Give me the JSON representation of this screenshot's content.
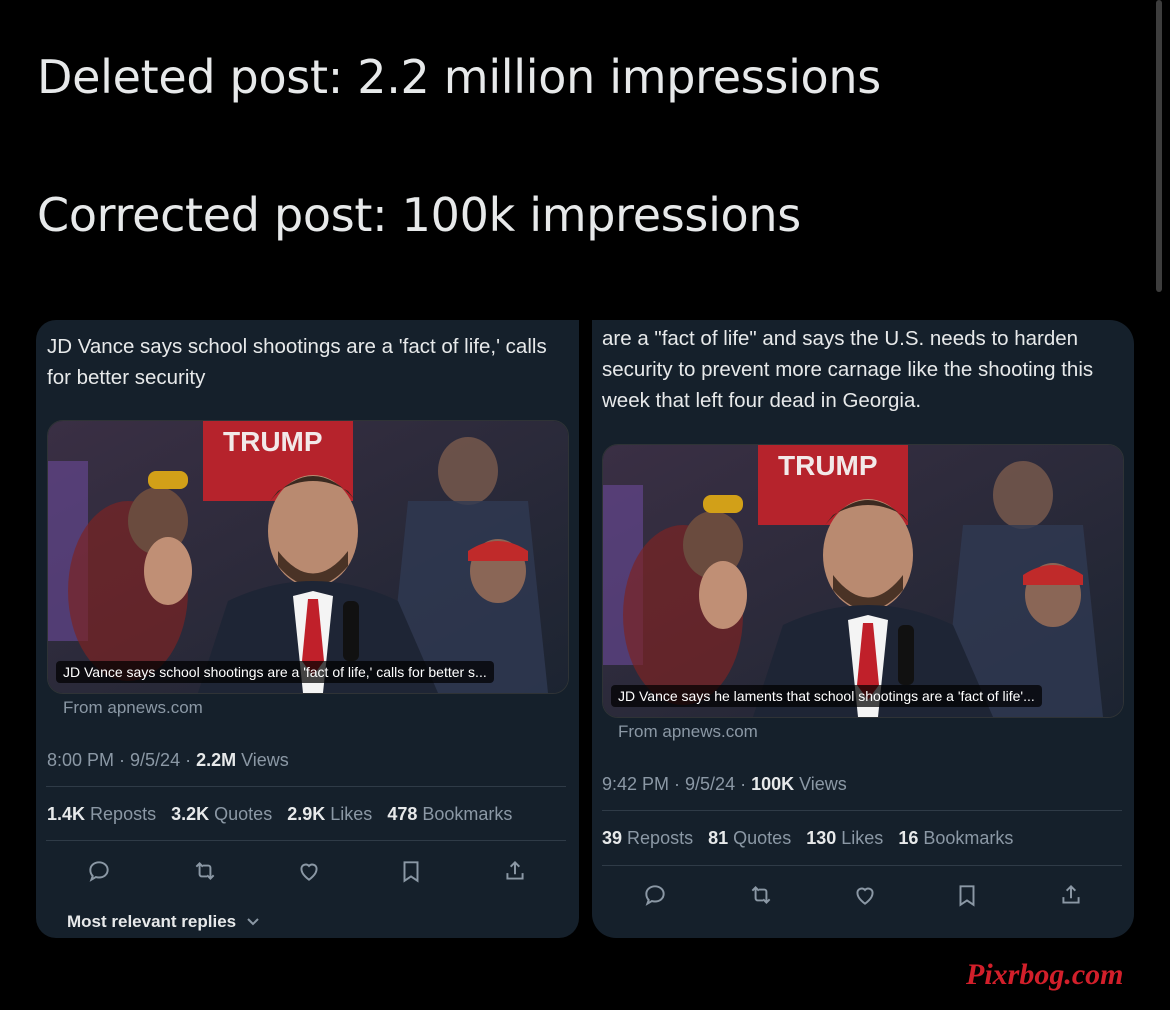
{
  "headlines": {
    "deleted": "Deleted post: 2.2 million impressions",
    "corrected": "Corrected post: 100k impressions"
  },
  "left_post": {
    "text": "JD Vance says school shootings are a 'fact of life,' calls for better security",
    "caption": "JD Vance says school shootings are a 'fact of life,' calls for better s...",
    "from": "From apnews.com",
    "time": "8:00 PM · 9/5/24 · ",
    "views_count": "2.2M",
    "views_label": " Views",
    "reposts": "1.4K",
    "reposts_label": "Reposts",
    "quotes": "3.2K",
    "quotes_label": "Quotes",
    "likes": "2.9K",
    "likes_label": "Likes",
    "bookmarks": "478",
    "bookmarks_label": "Bookmarks",
    "replies_label": "Most relevant replies"
  },
  "right_post": {
    "text": "are a \"fact of life\" and says the U.S. needs to harden security to prevent more carnage like the shooting this week that left four dead in Georgia.",
    "caption": "JD Vance says he laments that school shootings are a 'fact of life'...",
    "from": "From apnews.com",
    "time": "9:42 PM · 9/5/24 · ",
    "views_count": "100K",
    "views_label": " Views",
    "reposts": "39",
    "reposts_label": "Reposts",
    "quotes": "81",
    "quotes_label": "Quotes",
    "likes": "130",
    "likes_label": "Likes",
    "bookmarks": "16",
    "bookmarks_label": "Bookmarks"
  },
  "photo": {
    "sign_text": "TRUMP",
    "icons": [
      "reply-icon",
      "repost-icon",
      "like-icon",
      "bookmark-icon",
      "share-icon"
    ]
  },
  "colors": {
    "background": "#000000",
    "card": "#15202b",
    "text": "#e7e9ea",
    "muted": "#8b98a5",
    "watermark": "#d21f2a"
  },
  "watermark": "Pixrbog.com"
}
